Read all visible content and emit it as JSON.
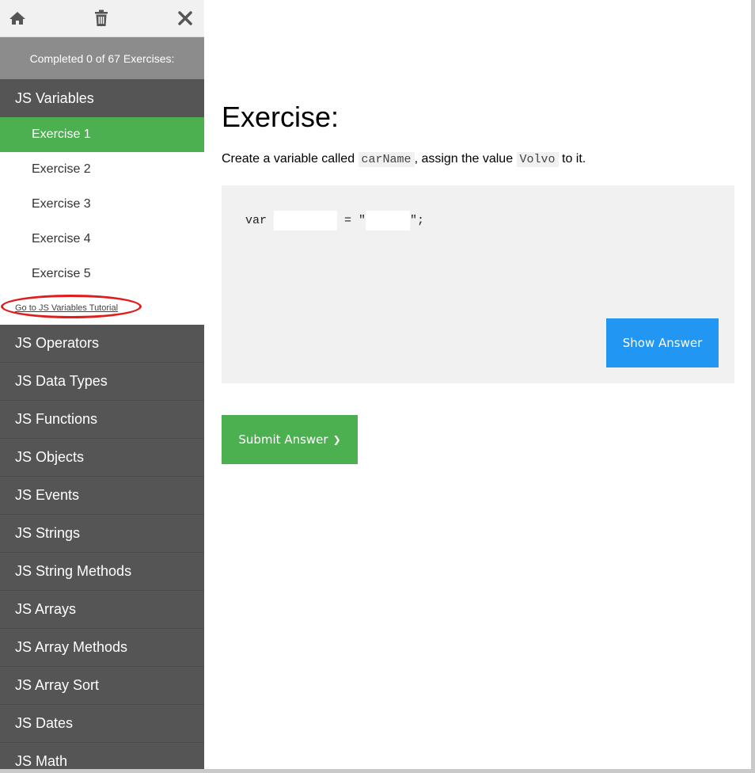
{
  "toolbar": {
    "home_icon": "home-icon",
    "trash_icon": "trash-icon",
    "close_icon": "close-icon"
  },
  "progress": {
    "text": "Completed 0 of 67 Exercises:",
    "completed": 0,
    "total": 67
  },
  "sidebar": {
    "open_category": "JS Variables",
    "exercises": [
      "Exercise 1",
      "Exercise 2",
      "Exercise 3",
      "Exercise 4",
      "Exercise 5"
    ],
    "active_exercise_index": 0,
    "tutorial_link": "Go to JS Variables Tutorial",
    "categories": [
      "JS Operators",
      "JS Data Types",
      "JS Functions",
      "JS Objects",
      "JS Events",
      "JS Strings",
      "JS String Methods",
      "JS Arrays",
      "JS Array Methods",
      "JS Array Sort",
      "JS Dates",
      "JS Math"
    ]
  },
  "main": {
    "title": "Exercise:",
    "instruction_prefix": "Create a variable called",
    "var_name": "carName",
    "instruction_middle": ", assign the value",
    "value_name": "Volvo",
    "instruction_suffix": "to it.",
    "code": {
      "keyword": "var",
      "equals_quote": " = \"",
      "end": "\";",
      "input1_value": "",
      "input2_value": ""
    },
    "show_answer_label": "Show Answer",
    "submit_label": "Submit Answer",
    "submit_chevron": "❯"
  },
  "colors": {
    "sidebar_bg": "#555555",
    "active_green": "#4caf50",
    "show_answer_blue": "#2196f3",
    "progress_gray": "#8c8c8c",
    "annotation_red": "#e01c1c"
  }
}
